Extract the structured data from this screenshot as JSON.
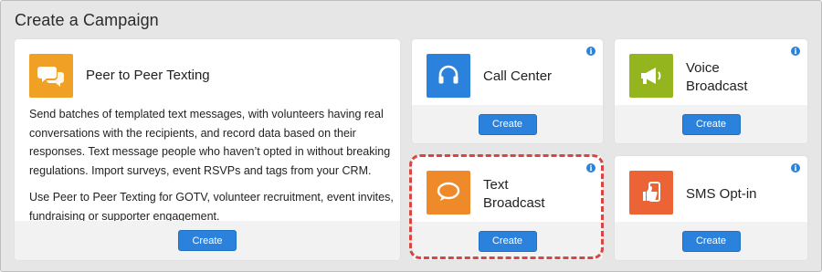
{
  "page": {
    "title": "Create a Campaign"
  },
  "cards": {
    "p2p": {
      "title": "Peer to Peer Texting",
      "description_1": "Send batches of templated text messages, with volunteers having real conversations with the recipients, and record data based on their responses. Text message people who haven’t opted in without breaking regulations. Import surveys, event RSVPs and tags from your CRM.",
      "description_2": "Use Peer to Peer Texting for GOTV, volunteer recruitment, event invites, fundraising or supporter engagement.",
      "button": "Create",
      "icon": "chat-bubbles-icon",
      "color": "#f0a025"
    },
    "call_center": {
      "title": "Call Center",
      "button": "Create",
      "icon": "headset-icon",
      "color": "#2b82dc",
      "info": "i"
    },
    "voice_broadcast": {
      "title_line1": "Voice",
      "title_line2": "Broadcast",
      "button": "Create",
      "icon": "megaphone-icon",
      "color": "#95b51e",
      "info": "i"
    },
    "text_broadcast": {
      "title_line1": "Text",
      "title_line2": "Broadcast",
      "button": "Create",
      "icon": "chat-bubble-icon",
      "color": "#ef8a2a",
      "info": "i"
    },
    "sms_optin": {
      "title": "SMS Opt-in",
      "button": "Create",
      "icon": "thumbs-up-phone-icon",
      "color": "#ec6336",
      "info": "i"
    }
  }
}
